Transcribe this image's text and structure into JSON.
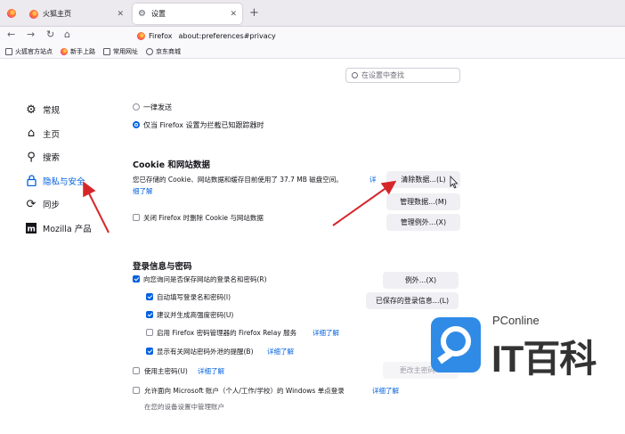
{
  "browser": {
    "tabs": [
      {
        "label": "火狐主页",
        "active": false
      },
      {
        "label": "设置",
        "active": true
      }
    ],
    "new_tab": "+",
    "url_brand": "Firefox",
    "url": "about:preferences#privacy",
    "bookmarks": [
      "火狐官方站点",
      "新手上路",
      "常用网址",
      "京东商城"
    ]
  },
  "search": {
    "placeholder": "在设置中查找"
  },
  "sidebar": {
    "items": [
      {
        "label": "常规",
        "icon": "gear-icon"
      },
      {
        "label": "主页",
        "icon": "home-icon"
      },
      {
        "label": "搜索",
        "icon": "search-icon"
      },
      {
        "label": "隐私与安全",
        "icon": "lock-icon"
      },
      {
        "label": "同步",
        "icon": "sync-icon"
      },
      {
        "label": "Mozilla 产品",
        "icon": "mozilla-icon"
      }
    ],
    "selected": "隐私与安全"
  },
  "dnt": {
    "option_always": "一律发送",
    "option_blocking": "仅当 Firefox 设置为拦截已知跟踪器时"
  },
  "cookies": {
    "heading": "Cookie 和网站数据",
    "desc": "您已存储的 Cookie、网站数据和缓存目前使用了 37.7 MB 磁盘空间。",
    "learn_more_1": "详",
    "learn_more_2": "细了解",
    "clear_button": "清除数据...(L)",
    "manage_button": "管理数据...(M)",
    "exceptions_button": "管理例外...(X)",
    "delete_on_close": "关闭 Firefox 时删除 Cookie 与网站数据"
  },
  "logins": {
    "heading": "登录信息与密码",
    "ask_save": "向您询问是否保存网站的登录名和密码(R)",
    "exceptions_button": "例外...(X)",
    "autofill": "自动填写登录名和密码(I)",
    "suggest": "建议并生成高强度密码(U)",
    "saved_logins_button": "已保存的登录信息...(L)",
    "relay": "启用 Firefox 密码管理器的 Firefox Relay 服务",
    "relay_learn": "详细了解",
    "breach_alerts": "显示有关网站密码外泄的提醒(B)",
    "breach_learn": "详细了解",
    "primary_password": "使用主密码(U)",
    "primary_learn": "详细了解",
    "change_primary_button": "更改主密码...",
    "windows_sso": "允许面向 Microsoft 账户（个人/工作/学校）的 Windows 单点登录",
    "windows_learn": "详细了解",
    "windows_note": "在您的设备设置中管理账户"
  },
  "watermark": {
    "brand": "PConline",
    "name": "IT百科"
  },
  "colors": {
    "accent": "#0061e0",
    "annotation_arrow": "#d6262a"
  }
}
